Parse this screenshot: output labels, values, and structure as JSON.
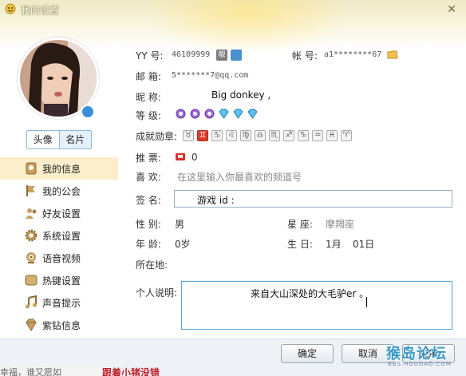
{
  "window": {
    "title": "我的设置"
  },
  "tabs": {
    "avatar": "头像",
    "card": "名片"
  },
  "sidebar": {
    "items": [
      {
        "label": "我的信息",
        "icon": "info-card-icon",
        "selected": true
      },
      {
        "label": "我的公会",
        "icon": "flag-icon",
        "selected": false
      },
      {
        "label": "好友设置",
        "icon": "friends-icon",
        "selected": false
      },
      {
        "label": "系统设置",
        "icon": "gear-icon",
        "selected": false
      },
      {
        "label": "语音视频",
        "icon": "webcam-icon",
        "selected": false
      },
      {
        "label": "热键设置",
        "icon": "hotkey-icon",
        "selected": false
      },
      {
        "label": "声音提示",
        "icon": "music-note-icon",
        "selected": false
      },
      {
        "label": "紫钻信息",
        "icon": "diamond-icon",
        "selected": false
      }
    ]
  },
  "profile": {
    "yy_label": "YY 号:",
    "yy_value": "46109999",
    "account_label": "帐 号:",
    "account_value": "a1********67",
    "email_label": "邮  箱:",
    "email_value": "5*******7@qq.com",
    "nickname_label": "昵  称:",
    "nickname_value": "Big donkey ,",
    "level_label": "等  级:",
    "medals_label": "成就勋章:",
    "tickets_label": "推  票:",
    "tickets_value": "0",
    "likes_label": "喜  欢:",
    "likes_placeholder": "在这里输入你最喜欢的频道号",
    "signature_label": "签  名:",
    "signature_value": "游戏 id :",
    "gender_label": "性  别:",
    "gender_value": "男",
    "zodiac_label": "星  座:",
    "zodiac_value": "摩羯座",
    "age_label": "年  龄:",
    "age_value": "0岁",
    "birthday_label": "生  日:",
    "birthday_month": "1月",
    "birthday_day": "01日",
    "location_label": "所在地:",
    "desc_label": "个人说明:",
    "desc_value": "来自大山深处的大毛驴er 。"
  },
  "medals": [
    "♉",
    "♊",
    "♋",
    "♌",
    "♍",
    "♎",
    "♏",
    "♐",
    "♑",
    "♒",
    "♓",
    "♈"
  ],
  "buttons": {
    "ok": "确定",
    "cancel": "取消",
    "apply": "应用"
  },
  "watermark": {
    "text": "猴岛论坛",
    "sub": "BBS.HOUDAO.COM"
  },
  "bottom_strip": {
    "text": "幸福，谁又愿如",
    "red": "跟着小猪没错"
  },
  "colors": {
    "accent": "#5fa7d6",
    "selected_bg": "#fbeecb",
    "medal_red": "#d93a2a",
    "level_purple": "#8a5cc4",
    "gem_blue": "#3aa6e0"
  }
}
